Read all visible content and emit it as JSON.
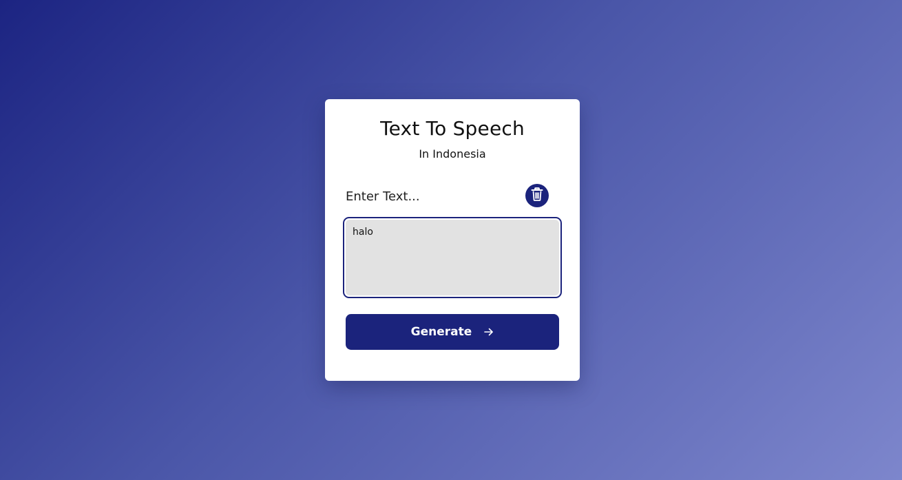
{
  "card": {
    "title": "Text To Speech",
    "subtitle": "In Indonesia",
    "input_label": "Enter Text...",
    "text_value": "halo",
    "generate_label": "Generate",
    "delete_icon": "trash-icon",
    "arrow_icon": "arrow-right-icon"
  },
  "colors": {
    "accent": "#1b237c",
    "textarea_bg": "#e2e2e2",
    "background_start": "#1c2482",
    "background_end": "#7d86cc"
  }
}
